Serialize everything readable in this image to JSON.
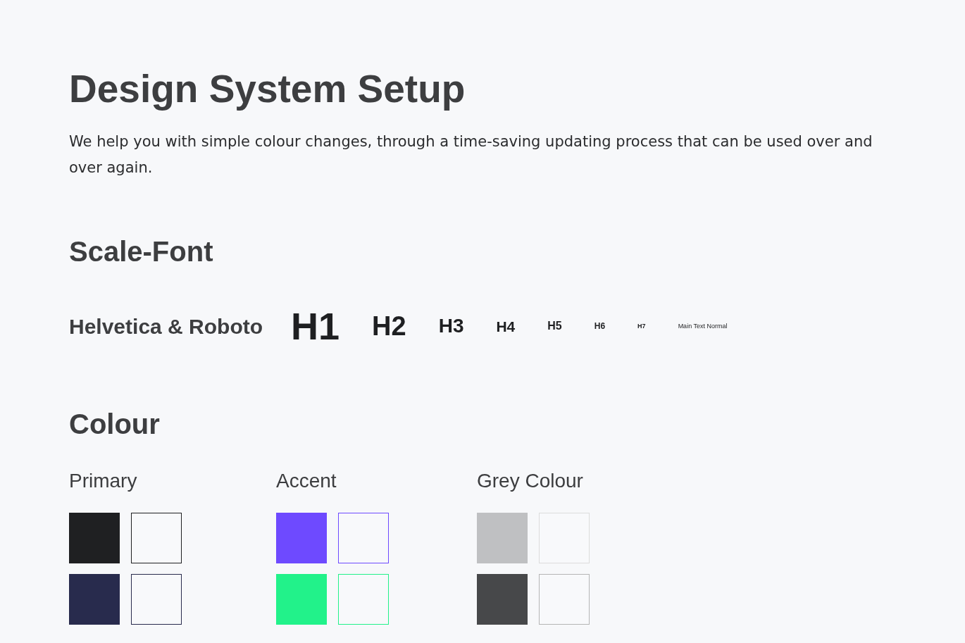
{
  "title": "Design System Setup",
  "intro": "We help you with simple colour changes, through a time-saving updating process that can be used over and over again.",
  "scale_font": {
    "heading": "Scale-Font",
    "family": "Helvetica & Roboto",
    "samples": [
      {
        "kind": "h1",
        "text": "H1"
      },
      {
        "kind": "h2",
        "text": "H2"
      },
      {
        "kind": "h3",
        "text": "H3"
      },
      {
        "kind": "h4",
        "text": "H4"
      },
      {
        "kind": "h5",
        "text": "H5"
      },
      {
        "kind": "h6",
        "text": "H6"
      },
      {
        "kind": "h7",
        "text": "H7"
      },
      {
        "kind": "body",
        "text": "Main Text Normal"
      }
    ]
  },
  "colour": {
    "heading": "Colour",
    "groups": [
      {
        "label": "Primary",
        "swatches": [
          {
            "kind": "filled",
            "color": "#1f2022"
          },
          {
            "kind": "outline",
            "color": "#1f2022"
          },
          {
            "kind": "filled",
            "color": "#282b4d"
          },
          {
            "kind": "outline",
            "color": "#282b4d"
          }
        ]
      },
      {
        "label": "Accent",
        "swatches": [
          {
            "kind": "filled",
            "color": "#6e4aff"
          },
          {
            "kind": "outline",
            "color": "#6e4aff"
          },
          {
            "kind": "filled",
            "color": "#22f28a"
          },
          {
            "kind": "outline",
            "color": "#22f28a"
          }
        ]
      },
      {
        "label": "Grey Colour",
        "swatches": [
          {
            "kind": "filled",
            "color": "#bfc0c2"
          },
          {
            "kind": "outline",
            "color": "#dcdcdc"
          },
          {
            "kind": "filled",
            "color": "#47484a"
          },
          {
            "kind": "outline",
            "color": "#b5b5b5"
          }
        ]
      }
    ]
  }
}
